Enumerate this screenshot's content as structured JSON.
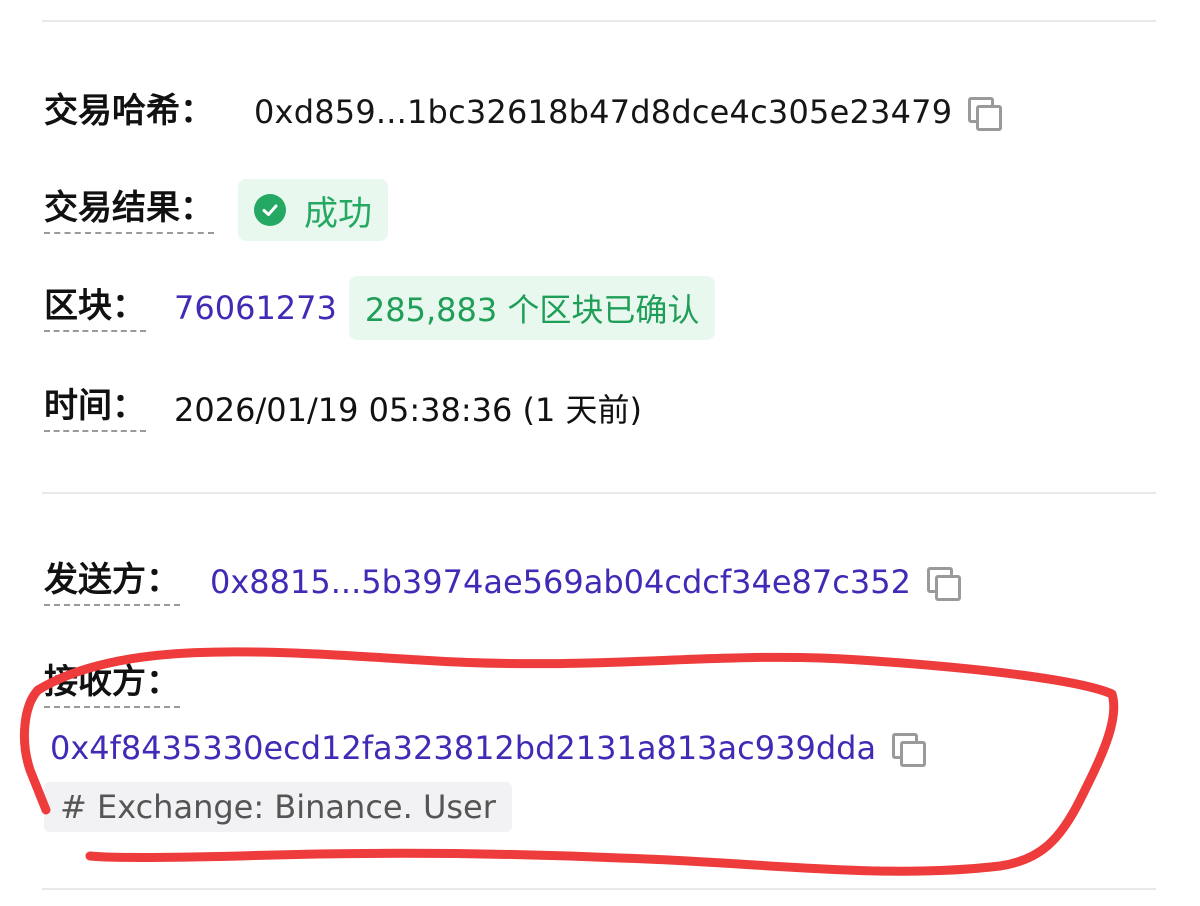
{
  "tx": {
    "hash_label": "交易哈希：",
    "hash_value": "0xd859...1bc32618b47d8dce4c305e23479",
    "result_label": "交易结果：",
    "result_value": "成功",
    "block_label": "区块：",
    "block_number": "76061273",
    "block_confirmations": "285,883 个区块已确认",
    "time_label": "时间：",
    "time_value": "2026/01/19 05:38:36 (1 天前)"
  },
  "parties": {
    "from_label": "发送方：",
    "from_value": "0x8815...5b3974ae569ab04cdcf34e87c352",
    "to_label": "接收方：",
    "to_value": "0x4f8435330ecd12fa323812bd2131a813ac939dda",
    "to_tag": "# Exchange: Binance. User"
  },
  "colors": {
    "link": "#3f2bb5",
    "success": "#24a862",
    "annotation": "#ee3b3b"
  },
  "icons": {
    "copy": "copy-icon",
    "success": "check-circle-icon"
  }
}
